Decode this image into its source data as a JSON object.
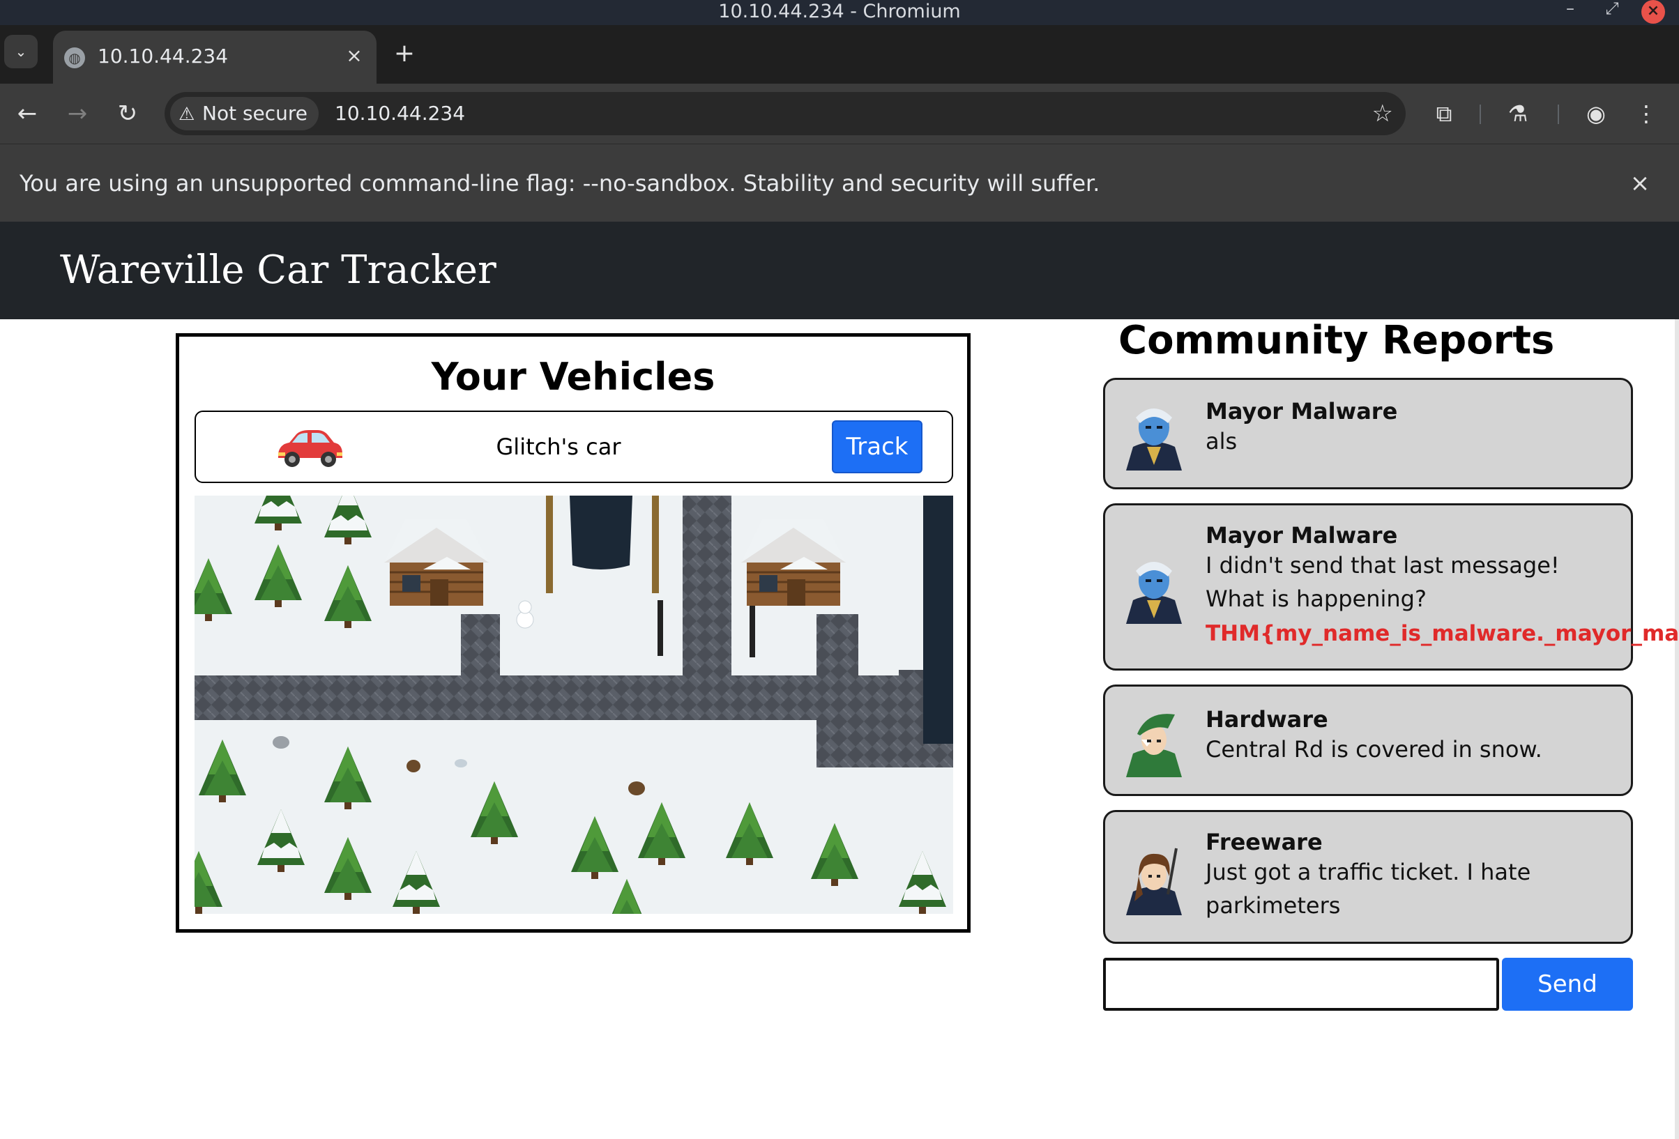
{
  "window": {
    "title": "10.10.44.234 - Chromium"
  },
  "tab": {
    "label": "10.10.44.234"
  },
  "address_bar": {
    "security_chip": "Not secure",
    "url": "10.10.44.234"
  },
  "infobar": {
    "message": "You are using an unsupported command-line flag: --no-sandbox. Stability and security will suffer."
  },
  "site": {
    "brand": "Wareville Car Tracker"
  },
  "vehicles": {
    "heading": "Your Vehicles",
    "items": [
      {
        "name": "Glitch's car",
        "action_label": "Track"
      }
    ]
  },
  "reports": {
    "heading": "Community Reports",
    "items": [
      {
        "author": "Mayor Malware",
        "text": "als"
      },
      {
        "author": "Mayor Malware",
        "text": "I didn't send that last message! What is happening?",
        "flag": "THM{my_name_is_malware._mayor_malware}"
      },
      {
        "author": "Hardware",
        "text": "Central Rd is covered in snow."
      },
      {
        "author": "Freeware",
        "text": "Just got a traffic ticket. I hate parkimeters"
      }
    ],
    "send_label": "Send",
    "input_value": ""
  },
  "colors": {
    "accent": "#1d6ff5",
    "header_bg": "#212529",
    "flag": "#e02a2a"
  },
  "icons": [
    "chevron-down-icon",
    "globe-icon",
    "close-icon",
    "plus-icon",
    "back-arrow-icon",
    "forward-arrow-icon",
    "reload-icon",
    "warning-icon",
    "star-icon",
    "extensions-icon",
    "labs-flask-icon",
    "profile-icon",
    "more-vert-icon",
    "car-icon"
  ]
}
